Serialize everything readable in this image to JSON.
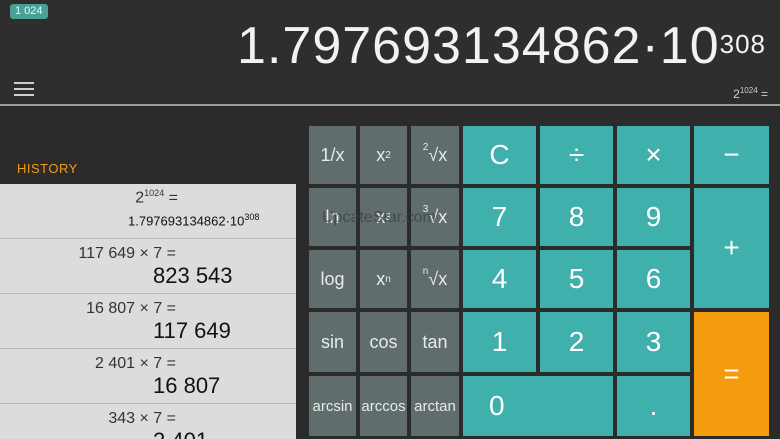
{
  "header": {
    "badge": "1 024",
    "display_mantissa": "1.797693134862·10",
    "display_exponent": "308",
    "expression_base": "2",
    "expression_exponent": "1024",
    "expression_suffix": " ="
  },
  "history": {
    "label": "HISTORY",
    "items": [
      {
        "expr_base": "2",
        "expr_exp": "1024",
        "expr_suffix": " =",
        "res_mantissa": "1.797693134862·10",
        "res_exp": "308"
      },
      {
        "expr": "117 649 × 7 =",
        "result": "823 543"
      },
      {
        "expr": "16 807 × 7 =",
        "result": "117 649"
      },
      {
        "expr": "2 401 × 7 =",
        "result": "16 807"
      },
      {
        "expr": "343 × 7 =",
        "result": "2 401"
      }
    ]
  },
  "scientific": {
    "reciprocal": "1/x",
    "square_base": "x",
    "square_exp": "2",
    "sqrt_idx": "2",
    "sqrt_sym": "√x",
    "ln": "ln",
    "cube_base": "x",
    "cube_exp": "3",
    "cbrt_idx": "3",
    "cbrt_sym": "√x",
    "log": "log",
    "pow_base": "x",
    "pow_exp": "n",
    "nroot_idx": "n",
    "nroot_sym": "√x",
    "sin": "sin",
    "cos": "cos",
    "tan": "tan",
    "arcsin": "arcsin",
    "arccos": "arccos",
    "arctan": "arctan"
  },
  "keypad": {
    "clear": "C",
    "divide": "÷",
    "multiply": "×",
    "minus": "−",
    "plus": "+",
    "equals": "=",
    "d7": "7",
    "d8": "8",
    "d9": "9",
    "d4": "4",
    "d5": "5",
    "d6": "6",
    "d1": "1",
    "d2": "2",
    "d3": "3",
    "d0": "0",
    "dot": "."
  },
  "watermark": "UpcateStar.com",
  "colors": {
    "accent": "#3fb0ab",
    "equals": "#f49c0d",
    "history_label": "#f39b1a",
    "sci": "#5f6d6c"
  }
}
